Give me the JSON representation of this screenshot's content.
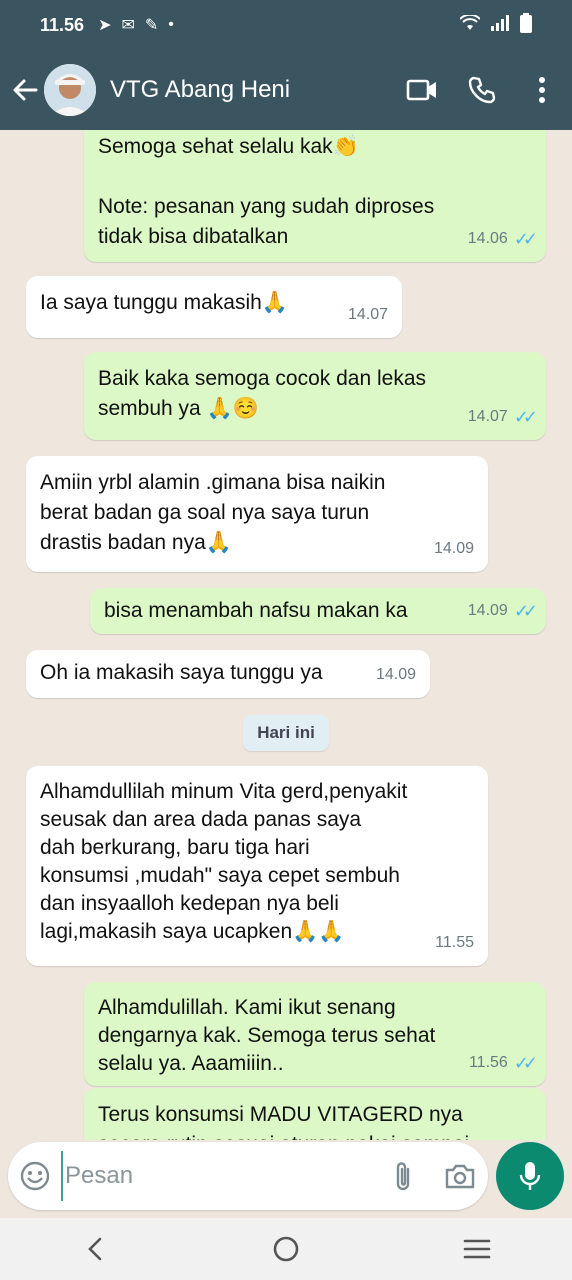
{
  "status_bar": {
    "time": "11.56"
  },
  "header": {
    "contact_name": "VTG Abang Heni"
  },
  "messages": [
    {
      "dir": "out",
      "text": "Semoga sehat selalu kak👏\n\nNote: pesanan yang sudah diproses\ntidak bisa dibatalkan",
      "time": "14.06",
      "read": true
    },
    {
      "dir": "in",
      "text": "Ia saya tunggu makasih🙏",
      "time": "14.07"
    },
    {
      "dir": "out",
      "text": "Baik kaka semoga cocok dan lekas\nsembuh ya 🙏☺️",
      "time": "14.07",
      "read": true
    },
    {
      "dir": "in",
      "text": "Amiin yrbl alamin .gimana bisa naikin\nberat badan ga soal nya saya turun\ndrastis badan nya🙏",
      "time": "14.09"
    },
    {
      "dir": "out",
      "text": "bisa menambah nafsu makan ka",
      "time": "14.09",
      "read": true
    },
    {
      "dir": "in",
      "text": "Oh ia makasih saya tunggu ya",
      "time": "14.09"
    },
    {
      "dir": "in",
      "text": "Alhamdullilah minum Vita gerd,penyakit\nseusak dan area dada panas saya\ndah berkurang, baru tiga hari\nkonsumsi ,mudah\" saya cepet sembuh\ndan insyaalloh kedepan nya beli\nlagi,makasih saya ucapken🙏🙏",
      "time": "11.55"
    },
    {
      "dir": "out",
      "text": "Alhamdulillah. Kami ikut senang\ndengarnya kak. Semoga terus sehat\nselalu ya. Aaamiiin..",
      "time": "11.56",
      "read": true
    },
    {
      "dir": "out",
      "text": "Terus konsumsi MADU VITAGERD nya\nsecara rutin sesuai aturan pakai sampai",
      "time": "",
      "read": false
    }
  ],
  "date_separator": "Hari ini",
  "composer": {
    "placeholder": "Pesan"
  },
  "colors": {
    "header": "#3b5560",
    "outgoing": "#dcf8c6",
    "incoming": "#ffffff",
    "accent": "#0b8a6f",
    "read_ticks": "#4fb6ec"
  }
}
